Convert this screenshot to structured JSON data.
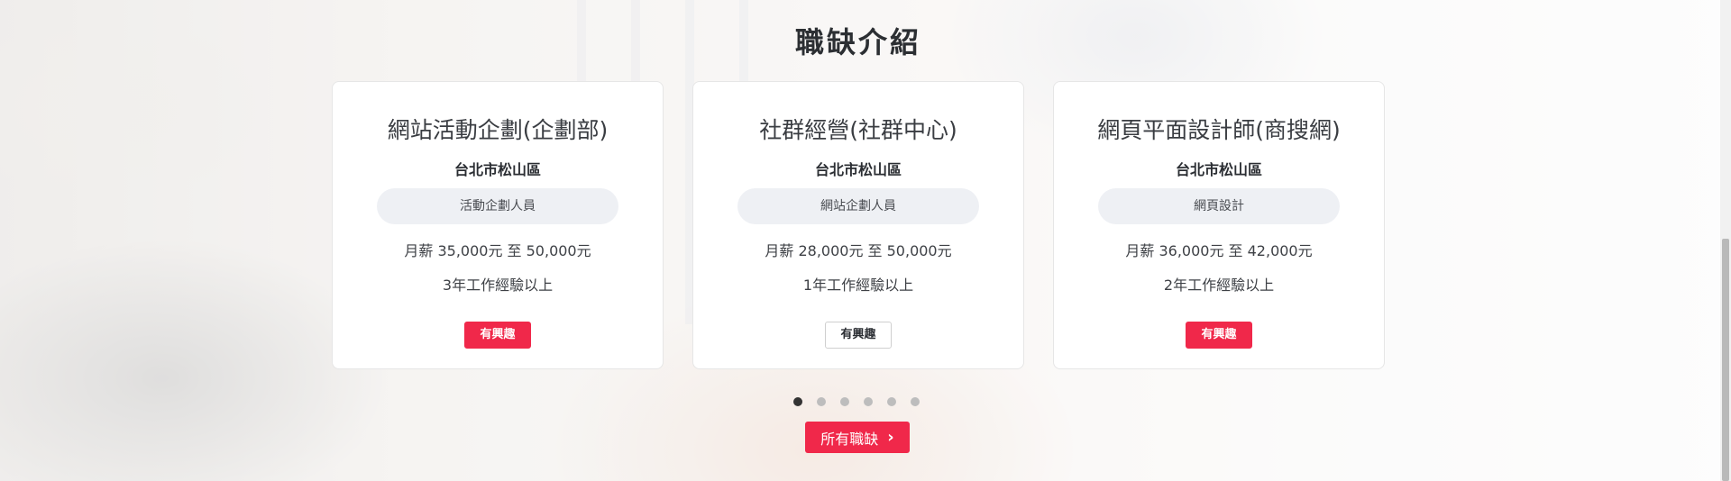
{
  "section": {
    "title": "職缺介紹"
  },
  "jobs": [
    {
      "title": "網站活動企劃(企劃部)",
      "location": "台北市松山區",
      "category": "活動企劃人員",
      "salary": "月薪 35,000元 至 50,000元",
      "experience": "3年工作經驗以上",
      "button": "有興趣",
      "button_style": "red"
    },
    {
      "title": "社群經營(社群中心)",
      "location": "台北市松山區",
      "category": "網站企劃人員",
      "salary": "月薪 28,000元 至 50,000元",
      "experience": "1年工作經驗以上",
      "button": "有興趣",
      "button_style": "white"
    },
    {
      "title": "網頁平面設計師(商搜網)",
      "location": "台北市松山區",
      "category": "網頁設計",
      "salary": "月薪 36,000元 至 42,000元",
      "experience": "2年工作經驗以上",
      "button": "有興趣",
      "button_style": "red"
    }
  ],
  "pagination": {
    "count": 6,
    "active_index": 0
  },
  "all_jobs_button": {
    "label": "所有職缺",
    "icon": "chevron-right-icon"
  },
  "colors": {
    "accent": "#f0284a",
    "card_bg": "#ffffff",
    "tag_bg": "#eef0f4"
  }
}
